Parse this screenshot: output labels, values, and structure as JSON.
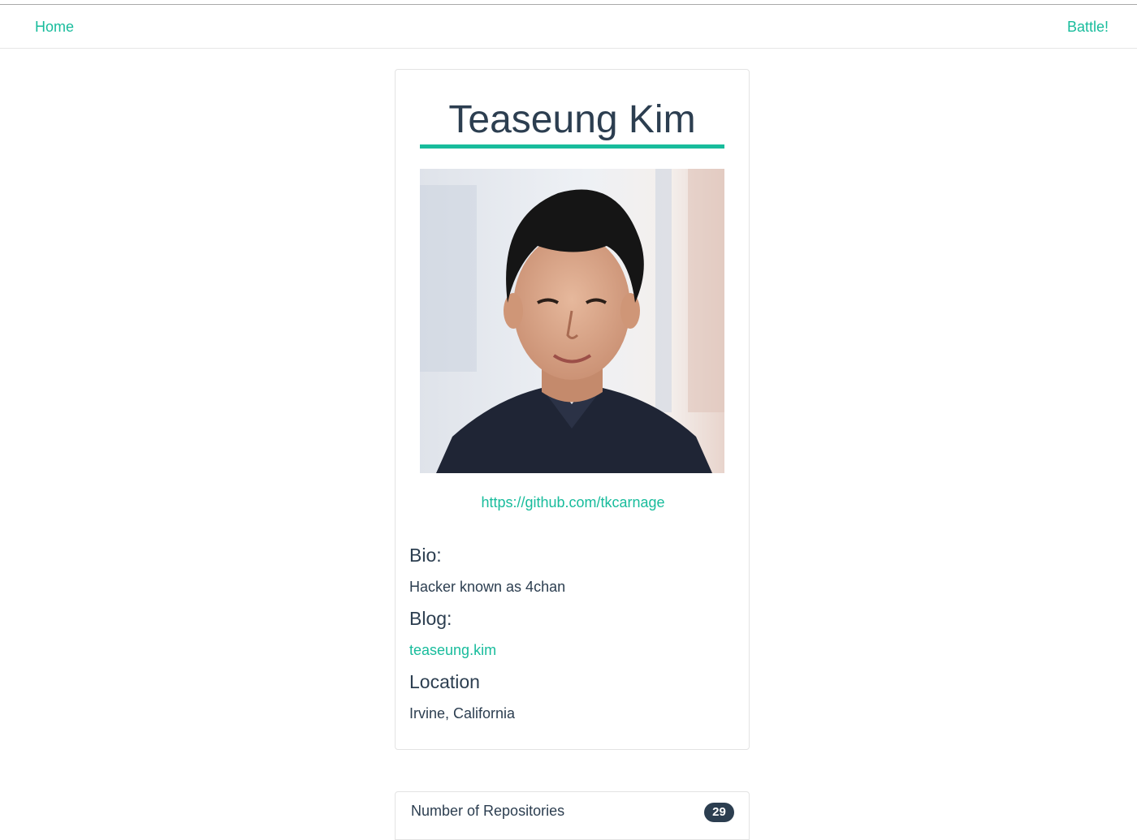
{
  "nav": {
    "home_label": "Home",
    "battle_label": "Battle!"
  },
  "profile": {
    "name": "Teaseung Kim",
    "avatar_icon": "avatar-photo",
    "github_url": "https://github.com/tkcarnage",
    "bio_title": "Bio:",
    "bio": "Hacker known as 4chan",
    "blog_title": "Blog:",
    "blog": "teaseung.kim",
    "location_title": "Location",
    "location": "Irvine, California"
  },
  "stats": {
    "label": "Number of Repositories",
    "value": "29"
  },
  "colors": {
    "accent": "#18bc9c",
    "text": "#2c3e50"
  }
}
